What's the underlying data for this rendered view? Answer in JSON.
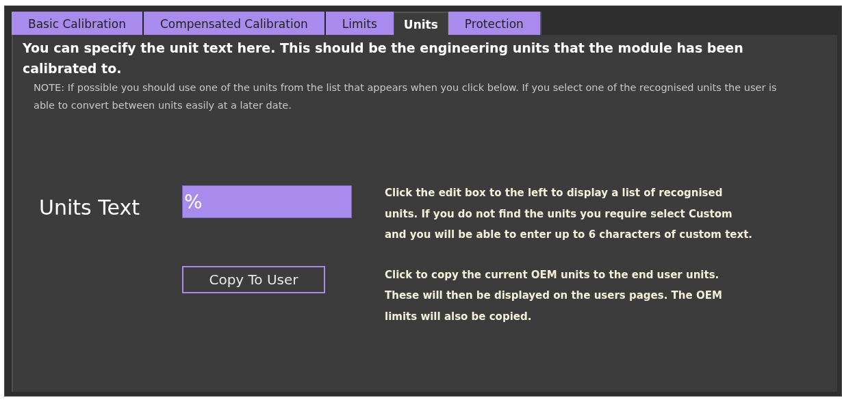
{
  "tabs": [
    {
      "label": "Basic Calibration",
      "selected": false
    },
    {
      "label": "Compensated Calibration",
      "selected": false
    },
    {
      "label": "Limits",
      "selected": false
    },
    {
      "label": "Units",
      "selected": true
    },
    {
      "label": "Protection",
      "selected": false
    }
  ],
  "heading": "You can specify the unit text here. This should be the engineering units that the module has been calibrated to.",
  "note": "NOTE: If possible you should use one of the units from the list that appears when you click below. If you select one of the recognised units the user is able to convert between units easily at a later date.",
  "units_field": {
    "label": "Units Text",
    "value": "%",
    "help": "Click the edit box to the left to display a list of recognised units. If you do not find the units you require select Custom and you will be able to enter up to 6 characters of custom text."
  },
  "copy_button": {
    "label": "Copy To User",
    "help": "Click to copy the current OEM units to the end user units. These will then be displayed on the users pages. The OEM limits will also be copied."
  }
}
